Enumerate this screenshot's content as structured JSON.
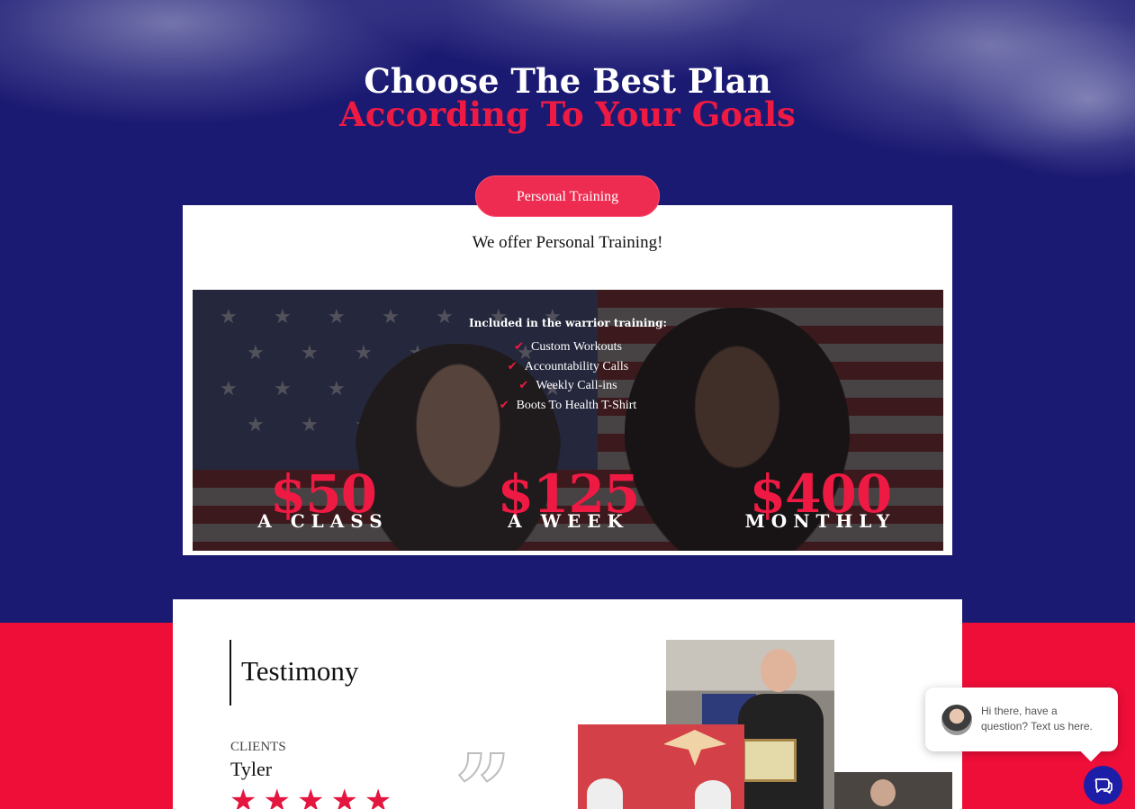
{
  "header": {
    "title_line1": "Choose The Best Plan",
    "title_line2": "According To Your Goals"
  },
  "plan_tab": {
    "label": "Personal Training"
  },
  "plan": {
    "heading": "We offer Personal Training!",
    "included_title": "Included in the warrior training:",
    "features": [
      "Custom Workouts",
      "Accountability Calls",
      "Weekly Call-ins",
      "Boots To Health T-Shirt"
    ],
    "prices": [
      {
        "amount": "$50",
        "period": "A CLASS"
      },
      {
        "amount": "$125",
        "period": "A WEEK"
      },
      {
        "amount": "$400",
        "period": "MONTHLY"
      }
    ]
  },
  "testimony": {
    "title": "Testimony",
    "clients_label": "CLIENTS",
    "client_name": "Tyler",
    "rating": 5,
    "stars": "★★★★★",
    "quote_glyph": "”"
  },
  "chat": {
    "message": "Hi there, have a question? Text us here."
  },
  "colors": {
    "navy": "#1b1a72",
    "red": "#ef0e38",
    "accent_pink": "#ee2b50",
    "chat_blue": "#1d1ea8"
  }
}
